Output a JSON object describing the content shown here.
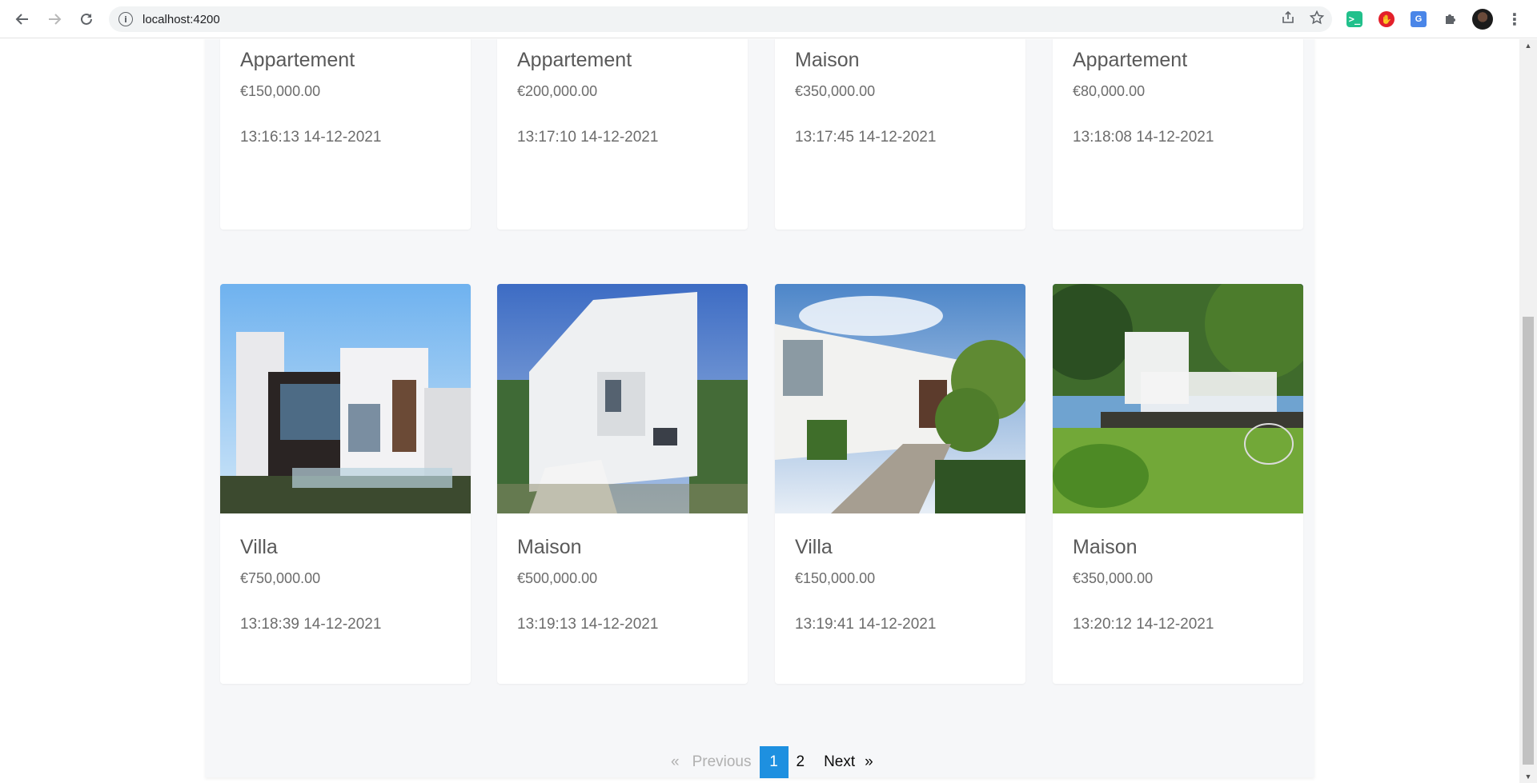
{
  "browser": {
    "url": "localhost:4200",
    "back_icon": "arrow-left",
    "forward_icon": "arrow-right",
    "reload_icon": "reload",
    "info_icon": "i"
  },
  "listings_row1": [
    {
      "type": "Appartement",
      "price": "€150,000.00",
      "date": "13:16:13 14-12-2021"
    },
    {
      "type": "Appartement",
      "price": "€200,000.00",
      "date": "13:17:10 14-12-2021"
    },
    {
      "type": "Maison",
      "price": "€350,000.00",
      "date": "13:17:45 14-12-2021"
    },
    {
      "type": "Appartement",
      "price": "€80,000.00",
      "date": "13:18:08 14-12-2021"
    }
  ],
  "listings_row2": [
    {
      "type": "Villa",
      "price": "€750,000.00",
      "date": "13:18:39 14-12-2021"
    },
    {
      "type": "Maison",
      "price": "€500,000.00",
      "date": "13:19:13 14-12-2021"
    },
    {
      "type": "Villa",
      "price": "€150,000.00",
      "date": "13:19:41 14-12-2021"
    },
    {
      "type": "Maison",
      "price": "€350,000.00",
      "date": "13:20:12 14-12-2021"
    }
  ],
  "pagination": {
    "prev_arrow": "«",
    "previous": "Previous",
    "pages": [
      "1",
      "2"
    ],
    "current": "1",
    "next": "Next",
    "next_arrow": "»"
  },
  "colors": {
    "accent": "#1e90e0",
    "page_bg": "#f6f7f9"
  }
}
